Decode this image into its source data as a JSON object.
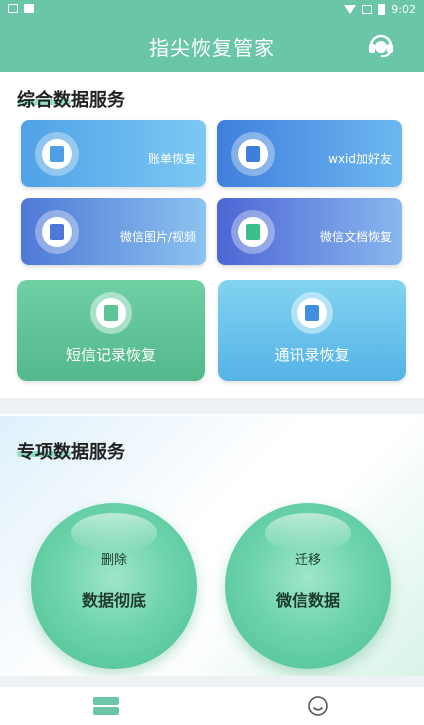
{
  "status_bar": {
    "time": "9:02"
  },
  "header": {
    "title": "指尖恢复管家",
    "service_icon": "headset-icon",
    "color": "#6ac6a4"
  },
  "general_section": {
    "title": "综合数据服务",
    "cards": [
      {
        "label": "账单恢复",
        "icon": "clipboard-icon"
      },
      {
        "label": "wxid加好友",
        "icon": "contact-book-icon"
      },
      {
        "label": "微信图片/视频",
        "icon": "image-icon"
      },
      {
        "label": "微信文档恢复",
        "icon": "document-icon"
      }
    ],
    "big_cards": [
      {
        "label": "短信记录恢复",
        "icon": "message-icon"
      },
      {
        "label": "通讯录恢复",
        "icon": "phone-book-icon"
      }
    ]
  },
  "special_section": {
    "title": "专项数据服务",
    "orbs": [
      {
        "small": "删除",
        "main": "数据彻底"
      },
      {
        "small": "迁移",
        "main": "微信数据"
      }
    ]
  },
  "bottom_nav": {
    "items": [
      "home-icon",
      "profile-icon"
    ]
  }
}
